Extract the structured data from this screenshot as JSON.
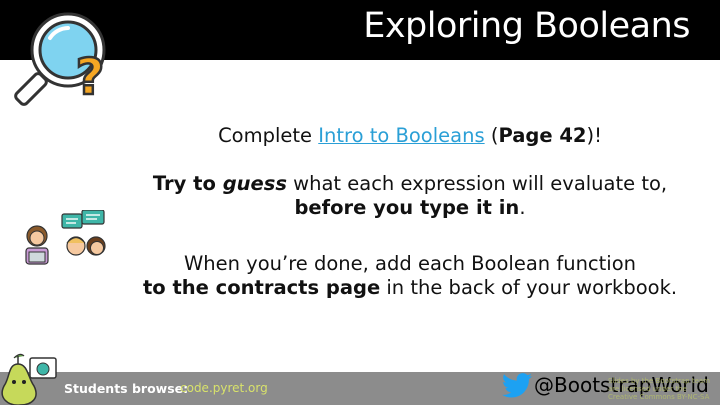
{
  "header": {
    "title": "Exploring Booleans"
  },
  "instructions": {
    "line1_prefix": "Complete ",
    "line1_link": "Intro to Booleans",
    "line1_open": " (",
    "line1_page": "Page 42",
    "line1_close": ")!",
    "line2_bold1": "Try to ",
    "line2_italic": "guess",
    "line2_rest": " what each expression will evaluate to,",
    "line2b_bold": "before you type it in",
    "line2b_end": ".",
    "line3a": "When you’re done, add each Boolean function",
    "line3b_bold": "to the contracts page",
    "line3b_rest": " in the back of your workbook."
  },
  "footer": {
    "label": "Students browse:",
    "link": "code.pyret.org",
    "handle": "@BootstrapWorld",
    "credit_line1": "Slides by the Bootstrap team are licensed under the",
    "credit_line2": "Creative Commons BY-NC-SA"
  },
  "icons": [
    "magnifier-question-icon",
    "students-chat-icon",
    "pear-mascot-icon",
    "twitter-bird-icon"
  ],
  "colors": {
    "header_bg": "#000000",
    "footer_bg": "#8c8c8c",
    "link": "#2a9fd6",
    "twitter": "#1da1f2"
  }
}
